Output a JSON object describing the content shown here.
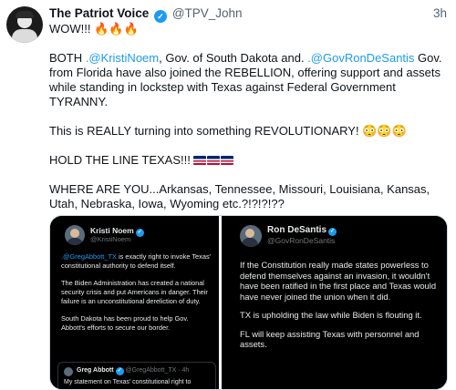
{
  "tweet": {
    "author_name": "The Patriot Voice",
    "author_handle": "@TPV_John",
    "time": "3h",
    "line1": "WOW!!! 🔥🔥🔥",
    "p2_a": "BOTH ",
    "p2_mention1": ".@KristiNoem",
    "p2_b": ", Gov. of South Dakota and. ",
    "p2_mention2": ".@GovRonDeSantis",
    "p2_c": " Gov. from Florida have also joined the REBELLION, offering support and assets while standing in lockstep with Texas against Federal Government TYRANNY.",
    "p3": "This is REALLY turning into something REVOLUTIONARY! 😳😳😳",
    "p4": "HOLD THE LINE TEXAS!!! ",
    "p5": "WHERE ARE YOU...Arkansas, Tennessee, Missouri, Louisiana, Kansas, Utah, Nebraska, Iowa, Wyoming etc.?!?!?!??"
  },
  "left_panel": {
    "name": "Kristi Noem",
    "handle": "@KristiNoem",
    "t1_mention": ".@GregAbbott_TX",
    "t1_rest": " is exactly right to invoke Texas' constitutional authority to defend itself.",
    "t2": "The Biden Administration has created a national security crisis and put Americans in danger. Their failure is an unconstitutional dereliction of duty.",
    "t3": "South Dakota has been proud to help Gov. Abbott's efforts to secure our border.",
    "quote_name": "Greg Abbott",
    "quote_meta": "@GregAbbott_TX · 4h",
    "quote_text": "My statement on Texas' constitutional right to"
  },
  "right_panel": {
    "name": "Ron DeSantis",
    "handle": "@GovRonDeSantis",
    "t1": "If the Constitution really made states powerless to defend themselves against an invasion, it wouldn't have been ratified in the first place and Texas would have never joined the union when it did.",
    "t2": "TX is upholding the law while Biden is flouting it.",
    "t3": "FL will keep assisting Texas with personnel and assets."
  }
}
